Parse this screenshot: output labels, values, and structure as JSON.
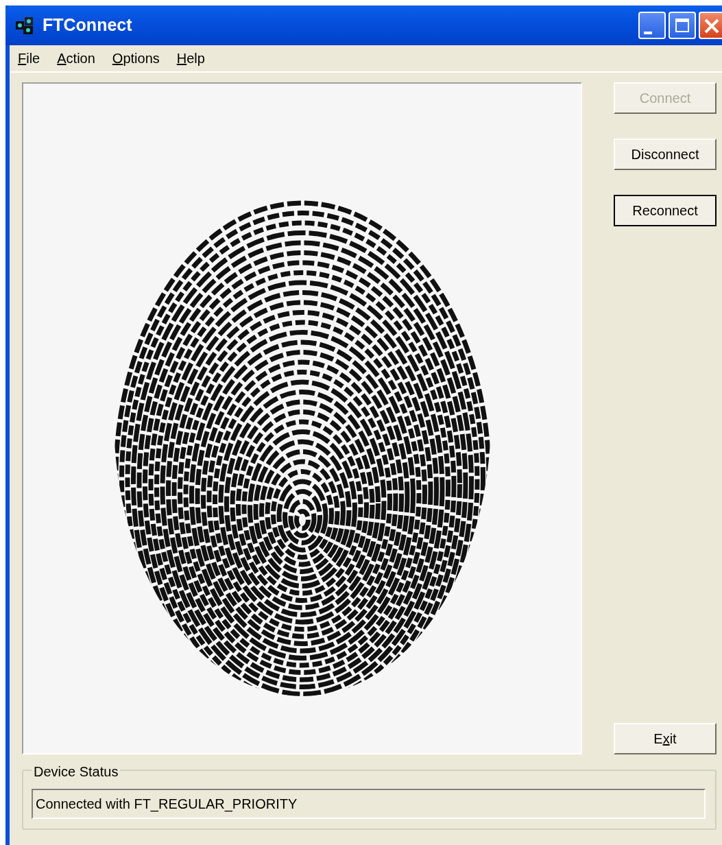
{
  "window": {
    "title": "FTConnect"
  },
  "menu": [
    {
      "access_key": "F",
      "after": "ile"
    },
    {
      "access_key": "A",
      "after": "ction"
    },
    {
      "access_key": "O",
      "after": "ptions"
    },
    {
      "access_key": "H",
      "after": "elp"
    }
  ],
  "buttons": [
    {
      "label": "Connect",
      "disabled": true,
      "default": false
    },
    {
      "label": "Disconnect",
      "disabled": false,
      "default": false
    },
    {
      "label": "Reconnect",
      "disabled": false,
      "default": true
    }
  ],
  "exit_button": {
    "before": "E",
    "access_key": "x",
    "after": "it"
  },
  "device_status": {
    "title": "Device Status",
    "value": "Connected with FT_REGULAR_PRIORITY"
  }
}
